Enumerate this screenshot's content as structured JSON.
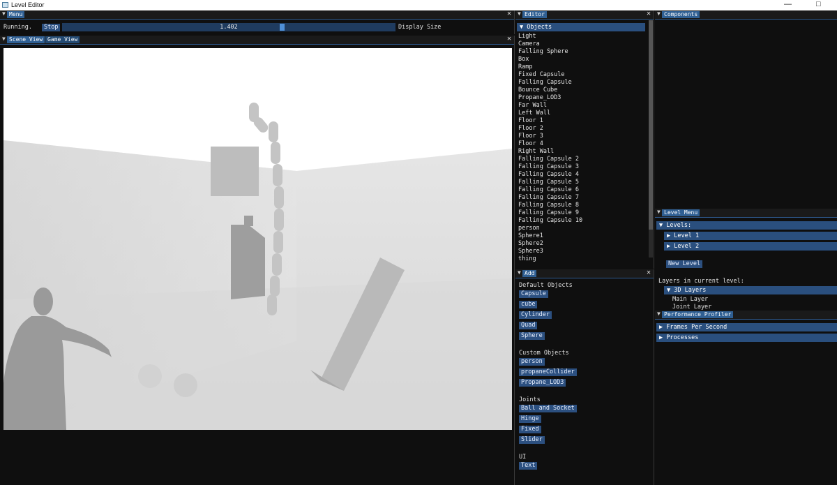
{
  "window": {
    "title": "Level Editor",
    "minimize": "—",
    "maximize": "□"
  },
  "menu_panel": {
    "tab": "Menu",
    "status": "Running.",
    "stop_label": "Stop",
    "slider_value": "1.402",
    "slider_fraction": 0.66,
    "display_size_label": "Display Size"
  },
  "view_panel": {
    "tabs": [
      "Scene View",
      "Game View"
    ]
  },
  "editor_panel": {
    "tab": "Editor",
    "objects_header": "Objects",
    "objects": [
      "Light",
      "Camera",
      "Falling Sphere",
      "Box",
      "Ramp",
      "Fixed Capsule",
      "Falling Capsule",
      "Bounce Cube",
      "Propane_LOD3",
      "Far Wall",
      "Left Wall",
      "Floor 1",
      "Floor 2",
      "Floor 3",
      "Floor 4",
      "Right Wall",
      "Falling Capsule 2",
      "Falling Capsule 3",
      "Falling Capsule 4",
      "Falling Capsule 5",
      "Falling Capsule 6",
      "Falling Capsule 7",
      "Falling Capsule 8",
      "Falling Capsule 9",
      "Falling Capsule 10",
      "person",
      "Sphere1",
      "Sphere2",
      "Sphere3",
      "thing"
    ]
  },
  "add_panel": {
    "tab": "Add",
    "default_title": "Default Objects",
    "default_buttons": [
      "Capsule",
      "cube",
      "Cylinder",
      "Quad",
      "Sphere"
    ],
    "custom_title": "Custom Objects",
    "custom_buttons": [
      "person",
      "propaneCollider",
      "Propane_LOD3"
    ],
    "joints_title": "Joints",
    "joint_buttons": [
      "Ball and Socket",
      "Hinge",
      "Fixed",
      "Slider"
    ],
    "ui_title": "UI",
    "ui_buttons": [
      "Text"
    ]
  },
  "components_panel": {
    "tab": "Components"
  },
  "level_menu": {
    "tab": "Level Menu",
    "levels_header": "Levels:",
    "levels": [
      "Level 1",
      "Level 2"
    ],
    "new_level_label": "New Level",
    "layers_title": "Layers in current level:",
    "layers_header": "3D Layers",
    "layers": [
      "Main Layer",
      "Joint Layer"
    ]
  },
  "profiler": {
    "tab": "Performance Profiler",
    "sections": [
      "Frames Per Second",
      "Processes"
    ]
  },
  "colors": {
    "accent": "#2f5f93",
    "header": "#2a4f7e",
    "panel_bg": "#0f0f0f"
  }
}
